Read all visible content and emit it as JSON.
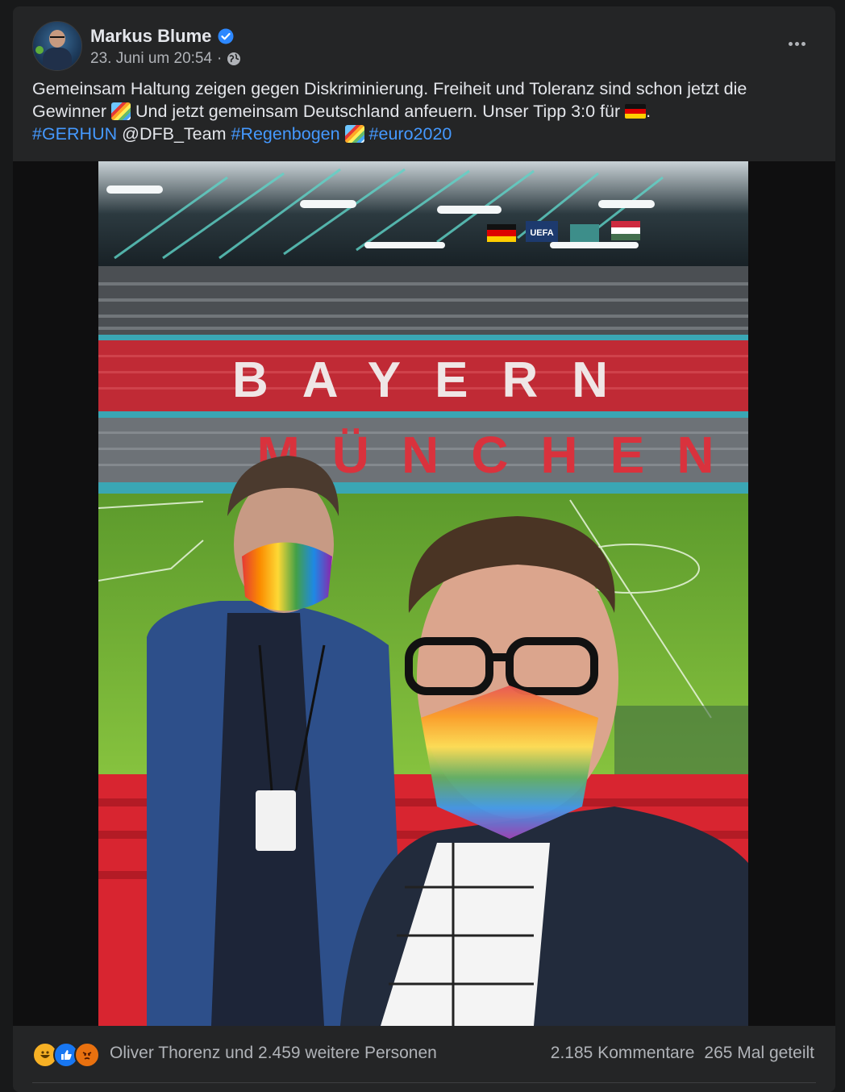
{
  "post": {
    "author": "Markus Blume",
    "timestamp": "23. Juni um 20:54",
    "separator": "·",
    "audience_icon": "globe-icon",
    "verified_icon": "verified-badge-icon",
    "more_icon": "more-options-icon",
    "text": {
      "part1": "Gemeinsam Haltung zeigen gegen Diskriminierung. Freiheit und Toleranz sind schon jetzt die Gewinner ",
      "part2": " Und jetzt gemeinsam Deutschland anfeuern. Unser Tipp 3:0 für ",
      "part3": ".",
      "hashtag1": "#GERHUN",
      "mention": "@DFB_Team",
      "hashtag2": "#Regenbogen",
      "hashtag3": "#euro2020"
    },
    "photo": {
      "stadium_text_top": "BAYERN",
      "stadium_text_bottom": "MÜNCHEN",
      "uefa_label": "UEFA"
    }
  },
  "footer": {
    "reaction_icons": [
      "haha-icon",
      "like-icon",
      "angry-icon"
    ],
    "reactions_text": "Oliver Thorenz und 2.459 weitere Personen",
    "comments": "2.185 Kommentare",
    "shares": "265 Mal geteilt"
  },
  "colors": {
    "background": "#18191a",
    "card": "#242526",
    "text": "#e4e6eb",
    "secondary_text": "#b0b3b8",
    "link": "#4599ff",
    "verified": "#2d88ff"
  }
}
